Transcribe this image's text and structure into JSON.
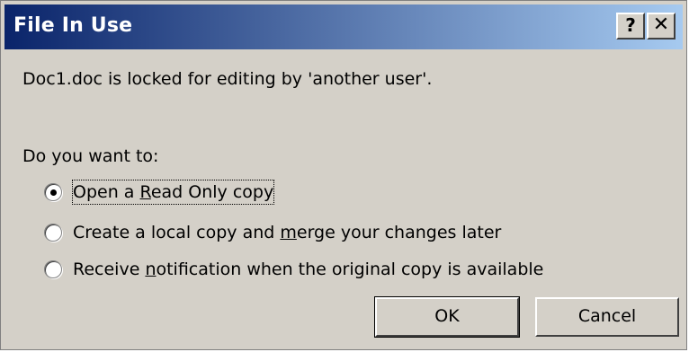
{
  "titlebar": {
    "title": "File In Use",
    "help_label": "?",
    "close_label": "✕",
    "gradient_start": "#0a246a",
    "gradient_end": "#a6caf0"
  },
  "message": "Doc1.doc is locked for editing by 'another user'.",
  "question": "Do you want to:",
  "options": [
    {
      "pre": "Open a ",
      "mnemonic": "R",
      "post": "ead Only copy",
      "selected": true
    },
    {
      "pre": "Create a local copy and ",
      "mnemonic": "m",
      "post": "erge your changes later",
      "selected": false
    },
    {
      "pre": "Receive ",
      "mnemonic": "n",
      "post": "otification when the original copy is available",
      "selected": false
    }
  ],
  "buttons": {
    "ok_label": "OK",
    "cancel_label": "Cancel"
  }
}
